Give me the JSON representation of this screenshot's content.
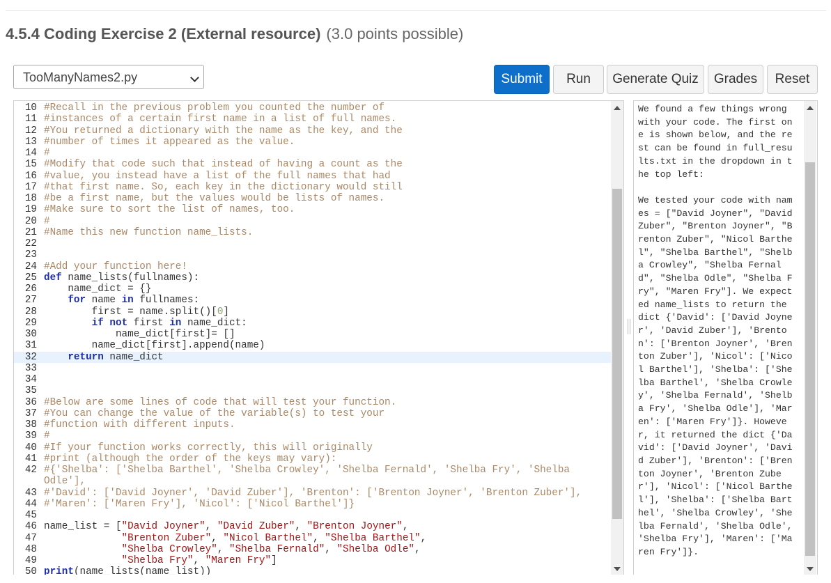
{
  "heading": {
    "title": "4.5.4 Coding Exercise 2 (External resource)",
    "points": "(3.0 points possible)"
  },
  "file_select": {
    "value": "TooManyNames2.py"
  },
  "toolbar": {
    "submit": "Submit",
    "run": "Run",
    "generate_quiz": "Generate Quiz",
    "grades": "Grades",
    "reset": "Reset"
  },
  "colors": {
    "primary_button": "#0d6fc9",
    "comment": "#aa8866",
    "keyword": "#1f2fa6",
    "string": "#a31515",
    "number": "#8aa36b",
    "highlight_line": "#e8f2fe"
  },
  "code_lines": [
    {
      "n": "10",
      "t": [
        [
          "c",
          "#Recall in the previous problem you counted the number of"
        ]
      ]
    },
    {
      "n": "11",
      "t": [
        [
          "c",
          "#instances of a certain first name in a list of full names."
        ]
      ]
    },
    {
      "n": "12",
      "t": [
        [
          "c",
          "#You returned a dictionary with the name as the key, and the"
        ]
      ]
    },
    {
      "n": "13",
      "t": [
        [
          "c",
          "#number of times it appeared as the value."
        ]
      ]
    },
    {
      "n": "14",
      "t": [
        [
          "c",
          "#"
        ]
      ]
    },
    {
      "n": "15",
      "t": [
        [
          "c",
          "#Modify that code such that instead of having a count as the"
        ]
      ]
    },
    {
      "n": "16",
      "t": [
        [
          "c",
          "#value, you instead have a list of the full names that had"
        ]
      ]
    },
    {
      "n": "17",
      "t": [
        [
          "c",
          "#that first name. So, each key in the dictionary would still"
        ]
      ]
    },
    {
      "n": "18",
      "t": [
        [
          "c",
          "#be a first name, but the values would be lists of names."
        ]
      ]
    },
    {
      "n": "19",
      "t": [
        [
          "c",
          "#Make sure to sort the list of names, too."
        ]
      ]
    },
    {
      "n": "20",
      "t": [
        [
          "c",
          "#"
        ]
      ]
    },
    {
      "n": "21",
      "t": [
        [
          "c",
          "#Name this new function name_lists."
        ]
      ]
    },
    {
      "n": "22",
      "t": []
    },
    {
      "n": "23",
      "t": []
    },
    {
      "n": "24",
      "t": [
        [
          "c",
          "#Add your function here!"
        ]
      ]
    },
    {
      "n": "25",
      "t": [
        [
          "k",
          "def"
        ],
        [
          "p",
          " name_lists(fullnames):"
        ]
      ]
    },
    {
      "n": "26",
      "t": [
        [
          "p",
          "    name_dict = {}"
        ]
      ]
    },
    {
      "n": "27",
      "t": [
        [
          "p",
          "    "
        ],
        [
          "k",
          "for"
        ],
        [
          "p",
          " name "
        ],
        [
          "k",
          "in"
        ],
        [
          "p",
          " fullnames:"
        ]
      ]
    },
    {
      "n": "28",
      "t": [
        [
          "p",
          "        first = name.split()["
        ],
        [
          "n",
          "0"
        ],
        [
          "p",
          "]"
        ]
      ]
    },
    {
      "n": "29",
      "t": [
        [
          "p",
          "        "
        ],
        [
          "k",
          "if"
        ],
        [
          "p",
          " "
        ],
        [
          "k",
          "not"
        ],
        [
          "p",
          " first "
        ],
        [
          "k",
          "in"
        ],
        [
          "p",
          " name_dict:"
        ]
      ]
    },
    {
      "n": "30",
      "t": [
        [
          "p",
          "            name_dict[first]= []"
        ]
      ]
    },
    {
      "n": "31",
      "t": [
        [
          "p",
          "        name_dict[first].append(name)"
        ]
      ]
    },
    {
      "n": "32",
      "hl": true,
      "t": [
        [
          "p",
          "    "
        ],
        [
          "k",
          "return"
        ],
        [
          "p",
          " name_dict"
        ]
      ]
    },
    {
      "n": "33",
      "t": []
    },
    {
      "n": "34",
      "t": []
    },
    {
      "n": "35",
      "t": []
    },
    {
      "n": "36",
      "t": [
        [
          "c",
          "#Below are some lines of code that will test your function."
        ]
      ]
    },
    {
      "n": "37",
      "t": [
        [
          "c",
          "#You can change the value of the variable(s) to test your"
        ]
      ]
    },
    {
      "n": "38",
      "t": [
        [
          "c",
          "#function with different inputs."
        ]
      ]
    },
    {
      "n": "39",
      "t": [
        [
          "c",
          "#"
        ]
      ]
    },
    {
      "n": "40",
      "t": [
        [
          "c",
          "#If your function works correctly, this will originally"
        ]
      ]
    },
    {
      "n": "41",
      "t": [
        [
          "c",
          "#print (although the order of the keys may vary):"
        ]
      ]
    },
    {
      "n": "42",
      "t": [
        [
          "c",
          "#{'Shelba': ['Shelba Barthel', 'Shelba Crowley', 'Shelba Fernald', 'Shelba Fry', 'Shelba"
        ]
      ]
    },
    {
      "n": "",
      "t": [
        [
          "c",
          "Odle'],"
        ]
      ]
    },
    {
      "n": "43",
      "t": [
        [
          "c",
          "#'David': ['David Joyner', 'David Zuber'], 'Brenton': ['Brenton Joyner', 'Brenton Zuber'],"
        ]
      ]
    },
    {
      "n": "44",
      "t": [
        [
          "c",
          "#'Maren': ['Maren Fry'], 'Nicol': ['Nicol Barthel']}"
        ]
      ]
    },
    {
      "n": "45",
      "t": []
    },
    {
      "n": "46",
      "t": [
        [
          "p",
          "name_list = ["
        ],
        [
          "s",
          "\"David Joyner\""
        ],
        [
          "p",
          ", "
        ],
        [
          "s",
          "\"David Zuber\""
        ],
        [
          "p",
          ", "
        ],
        [
          "s",
          "\"Brenton Joyner\""
        ],
        [
          "p",
          ","
        ]
      ]
    },
    {
      "n": "47",
      "t": [
        [
          "p",
          "             "
        ],
        [
          "s",
          "\"Brenton Zuber\""
        ],
        [
          "p",
          ", "
        ],
        [
          "s",
          "\"Nicol Barthel\""
        ],
        [
          "p",
          ", "
        ],
        [
          "s",
          "\"Shelba Barthel\""
        ],
        [
          "p",
          ","
        ]
      ]
    },
    {
      "n": "48",
      "t": [
        [
          "p",
          "             "
        ],
        [
          "s",
          "\"Shelba Crowley\""
        ],
        [
          "p",
          ", "
        ],
        [
          "s",
          "\"Shelba Fernald\""
        ],
        [
          "p",
          ", "
        ],
        [
          "s",
          "\"Shelba Odle\""
        ],
        [
          "p",
          ","
        ]
      ]
    },
    {
      "n": "49",
      "t": [
        [
          "p",
          "             "
        ],
        [
          "s",
          "\"Shelba Fry\""
        ],
        [
          "p",
          ", "
        ],
        [
          "s",
          "\"Maren Fry\""
        ],
        [
          "p",
          "]"
        ]
      ]
    },
    {
      "n": "50",
      "t": [
        [
          "k",
          "print"
        ],
        [
          "p",
          "(name_lists(name_list))"
        ]
      ]
    }
  ],
  "output_text": "We found a few things wrong with your code. The first one is shown below, and the rest can be found in full_results.txt in the dropdown in the top left:\n\nWe tested your code with names = [\"David Joyner\", \"David Zuber\", \"Brenton Joyner\", \"Brenton Zuber\", \"Nicol Barthel\", \"Shelba Barthel\", \"Shelba Crowley\", \"Shelba Fernald\", \"Shelba Odle\", \"Shelba Fry\", \"Maren Fry\"]. We expected name_lists to return the dict {'David': ['David Joyner', 'David Zuber'], 'Brenton': ['Brenton Joyner', 'Brenton Zuber'], 'Nicol': ['Nicol Barthel'], 'Shelba': ['Shelba Barthel', 'Shelba Crowley', 'Shelba Fernald', 'Shelba Fry', 'Shelba Odle'], 'Maren': ['Maren Fry']}. However, it returned the dict {'David': ['David Joyner', 'David Zuber'], 'Brenton': ['Brenton Joyner', 'Brenton Zuber'], 'Nicol': ['Nicol Barthel'], 'Shelba': ['Shelba Barthel', 'Shelba Crowley', 'Shelba Fernald', 'Shelba Odle', 'Shelba Fry'], 'Maren': ['Maren Fry']}."
}
